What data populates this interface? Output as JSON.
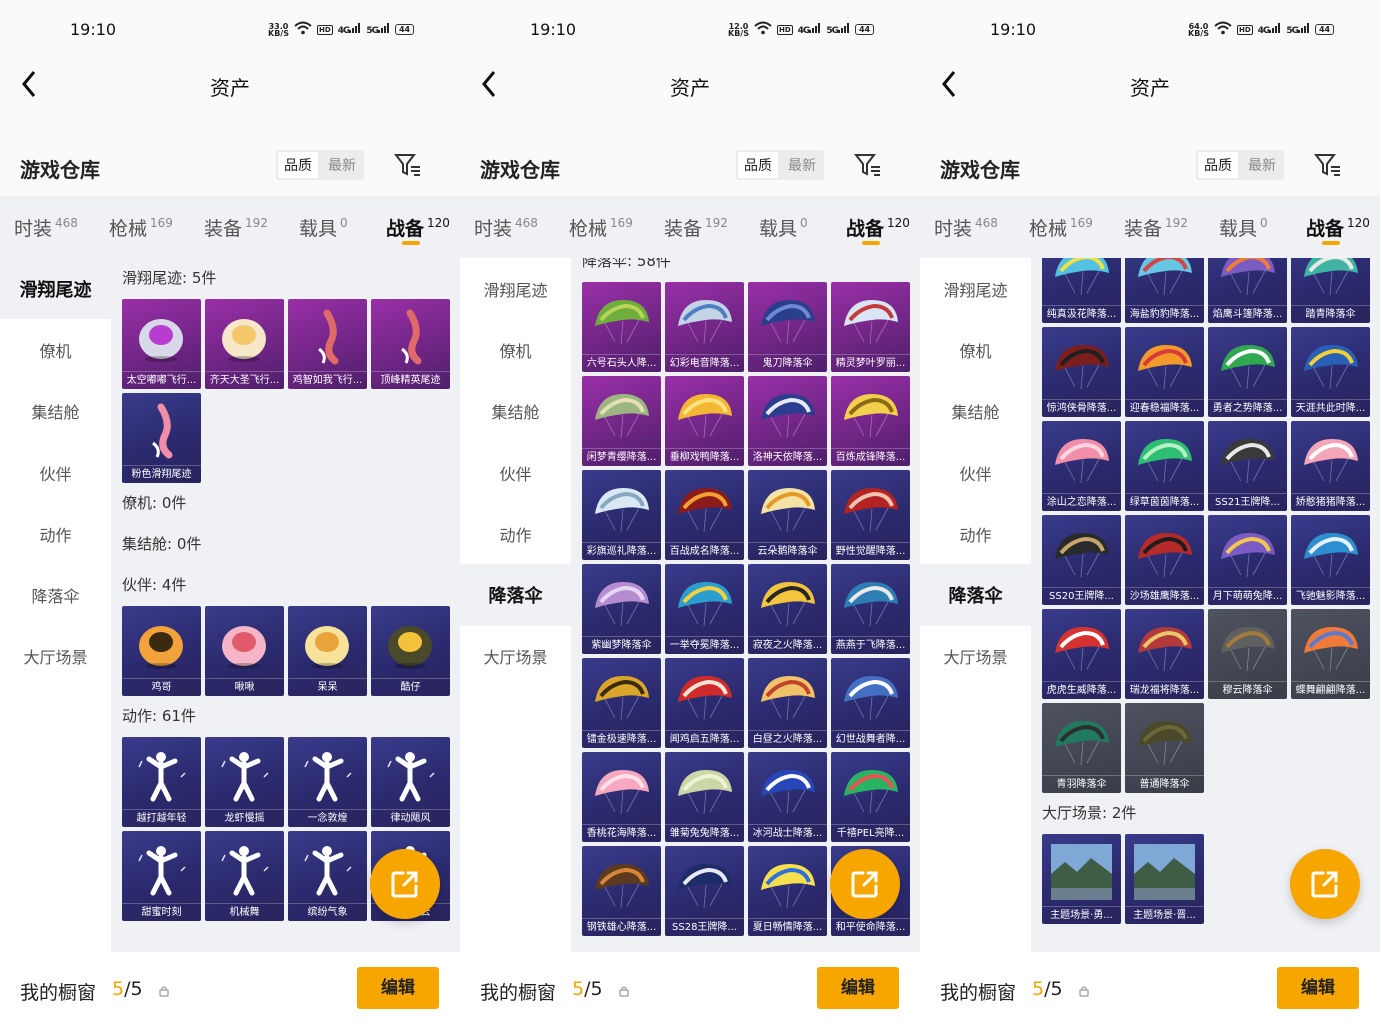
{
  "screens": [
    {
      "status": {
        "time": "19:10",
        "speed_value": "33.0",
        "speed_unit": "KB/S",
        "hd": "HD",
        "signal1": "4G",
        "signal2": "5G",
        "battery": "44"
      },
      "title": "资产",
      "warehouse_title": "游戏仓库",
      "sort_options": [
        "品质",
        "最新"
      ],
      "tabs": [
        {
          "label": "时装",
          "count": "468"
        },
        {
          "label": "枪械",
          "count": "169"
        },
        {
          "label": "装备",
          "count": "192"
        },
        {
          "label": "载具",
          "count": "0"
        },
        {
          "label": "战备",
          "count": "120"
        }
      ],
      "sidebar": [
        "滑翔尾迹",
        "僚机",
        "集结舱",
        "伙伴",
        "动作",
        "降落伞",
        "大厅场景"
      ],
      "active_side_index": 0,
      "sections": [
        {
          "header": "滑翔尾迹: 5件",
          "items": [
            "太空嘟嘟飞行...",
            "齐天大圣飞行...",
            "鸡智如我飞行...",
            "顶峰精英尾迹",
            "粉色滑翔尾迹"
          ]
        },
        {
          "header": "僚机: 0件",
          "items": []
        },
        {
          "header": "集结舱: 0件",
          "items": []
        },
        {
          "header": "伙伴: 4件",
          "items": [
            "鸡哥",
            "啾啾",
            "呆呆",
            "酷仔"
          ]
        },
        {
          "header": "动作: 61件",
          "items": [
            "越打越年轻",
            "龙虾慢摇",
            "一念敦煌",
            "律动飓风",
            "甜蜜时刻",
            "机械舞",
            "缤纷气象",
            "浪漫星云"
          ]
        }
      ],
      "bottom": {
        "label": "我的橱窗",
        "count_current": "5",
        "count_sep": "/",
        "count_total": "5",
        "edit_label": "编辑"
      }
    },
    {
      "status": {
        "time": "19:10",
        "speed_value": "12.0",
        "speed_unit": "KB/S",
        "hd": "HD",
        "signal1": "4G",
        "signal2": "5G",
        "battery": "44"
      },
      "title": "资产",
      "warehouse_title": "游戏仓库",
      "sort_options": [
        "品质",
        "最新"
      ],
      "tabs": [
        {
          "label": "时装",
          "count": "468"
        },
        {
          "label": "枪械",
          "count": "169"
        },
        {
          "label": "装备",
          "count": "192"
        },
        {
          "label": "载具",
          "count": "0"
        },
        {
          "label": "战备",
          "count": "120"
        }
      ],
      "sidebar": [
        "滑翔尾迹",
        "僚机",
        "集结舱",
        "伙伴",
        "动作",
        "降落伞",
        "大厅场景"
      ],
      "active_side_index": 5,
      "sections": [
        {
          "header": "降落伞: 58件",
          "items": [
            "六号石头人降...",
            "幻彩电音降落...",
            "鬼刀降落伞",
            "精灵梦叶罗丽...",
            "闲梦青缨降落...",
            "垂柳戏鸭降落...",
            "洛神天依降落...",
            "百炼成锋降落...",
            "彩旗巡礼降落...",
            "百战成名降落...",
            "云朵鹅降落伞",
            "野性觉醒降落...",
            "紫幽梦降落伞",
            "一举夺冕降落...",
            "寂夜之火降落...",
            "燕燕于飞降落...",
            "镭金极速降落...",
            "闻鸡启五降落...",
            "白昼之火降落...",
            "幻世战舞者降...",
            "香桃花海降落...",
            "雏菊兔兔降落...",
            "冰河战士降落...",
            "千禧PEL亮降...",
            "钢铁雄心降落...",
            "SS28王牌降...",
            "夏日畅情降落...",
            "和平使命降落..."
          ]
        }
      ],
      "bottom": {
        "label": "我的橱窗",
        "count_current": "5",
        "count_sep": "/",
        "count_total": "5",
        "edit_label": "编辑"
      }
    },
    {
      "status": {
        "time": "19:10",
        "speed_value": "64.0",
        "speed_unit": "KB/S",
        "hd": "HD",
        "signal1": "4G",
        "signal2": "5G",
        "battery": "44"
      },
      "title": "资产",
      "warehouse_title": "游戏仓库",
      "sort_options": [
        "品质",
        "最新"
      ],
      "tabs": [
        {
          "label": "时装",
          "count": "468"
        },
        {
          "label": "枪械",
          "count": "169"
        },
        {
          "label": "装备",
          "count": "192"
        },
        {
          "label": "载具",
          "count": "0"
        },
        {
          "label": "战备",
          "count": "120"
        }
      ],
      "sidebar": [
        "滑翔尾迹",
        "僚机",
        "集结舱",
        "伙伴",
        "动作",
        "降落伞",
        "大厅场景"
      ],
      "active_side_index": 5,
      "sections": [
        {
          "header": "",
          "items": [
            "纯真汲花降落...",
            "海盐豹豹降落...",
            "焰鹰斗篷降落...",
            "踏青降落伞",
            "惊鸿侠骨降落...",
            "迎春稳福降落...",
            "勇者之势降落...",
            "天涯共此时降...",
            "涂山之恋降落...",
            "绿草茵茵降落...",
            "SS21王牌降...",
            "娇憨猪猪降落...",
            "SS20王牌降...",
            "沙场雄鹰降落...",
            "月下萌萌兔降...",
            "飞驰魅影降落...",
            "虎虎生威降落...",
            "瑞龙福将降落...",
            "穆云降落伞",
            "蝶舞翩翩降落...",
            "青羽降落伞",
            "普通降落伞"
          ]
        },
        {
          "header": "大厅场景: 2件",
          "items": [
            "主题场景·勇...",
            "主题场景·晋..."
          ]
        }
      ],
      "bottom": {
        "label": "我的橱窗",
        "count_current": "5",
        "count_sep": "/",
        "count_total": "5",
        "edit_label": "编辑"
      }
    }
  ],
  "colors": {
    "accent": "#f7a600",
    "card_blue": "#2f2e78",
    "card_purple": "#7a2a90",
    "panel_bg": "#f0f1f4"
  }
}
